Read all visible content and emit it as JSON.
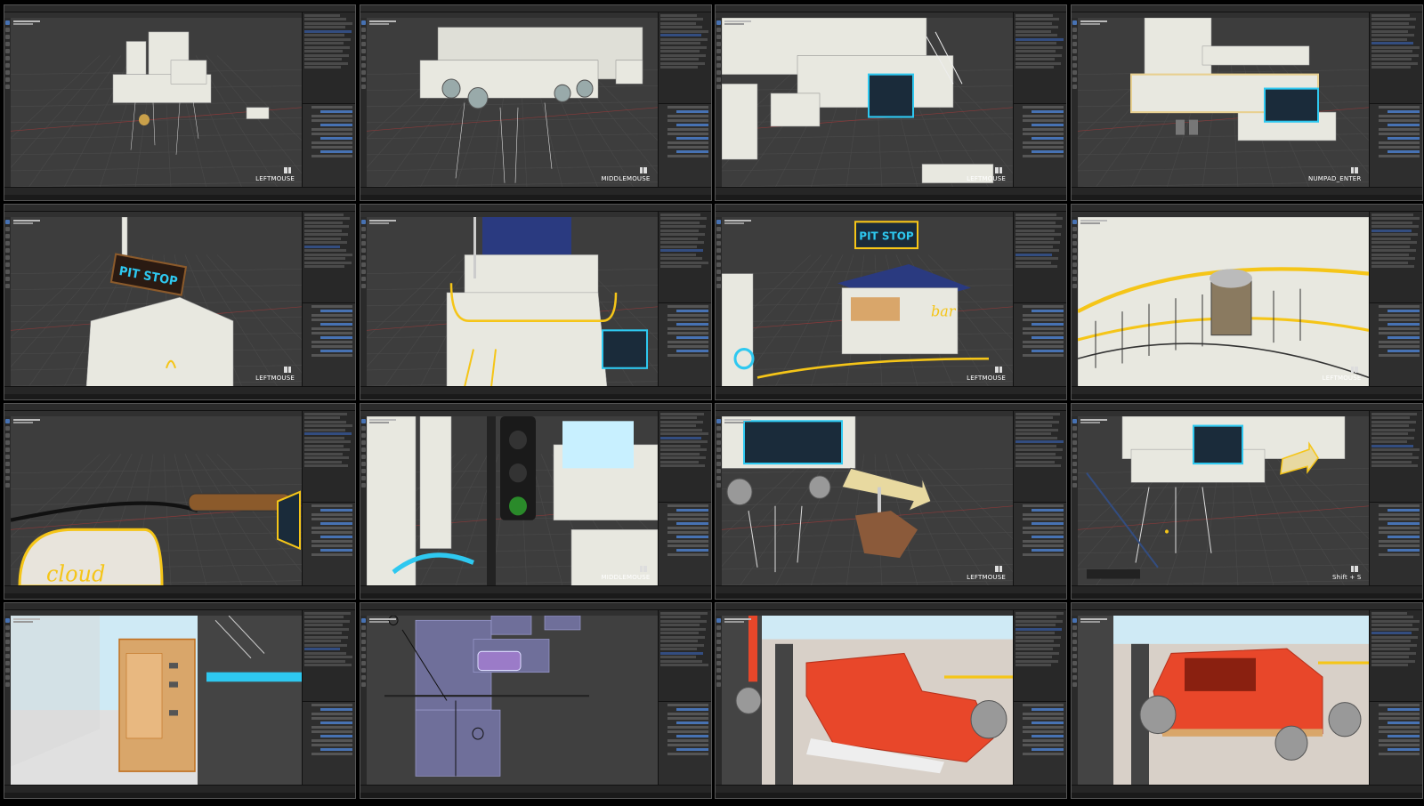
{
  "frames": [
    {
      "keycast": "LEFTMOUSE"
    },
    {
      "keycast": "MIDDLEMOUSE"
    },
    {
      "keycast": "LEFTMOUSE"
    },
    {
      "keycast": "NUMPAD_ENTER"
    },
    {
      "keycast": "LEFTMOUSE"
    },
    {
      "keycast": ""
    },
    {
      "keycast": "LEFTMOUSE"
    },
    {
      "keycast": "LEFTMOUSE"
    },
    {
      "keycast": ""
    },
    {
      "keycast": "MIDDLEMOUSE"
    },
    {
      "keycast": "LEFTMOUSE"
    },
    {
      "keycast": "Shift + S"
    },
    {
      "keycast": ""
    },
    {
      "keycast": ""
    },
    {
      "keycast": ""
    },
    {
      "keycast": ""
    }
  ],
  "scene_text": {
    "pitstop_sign": "PIT STOP",
    "cloud_sign": "cloud",
    "bar_sign": "bar",
    "bar_sign_2": "bar"
  },
  "colors": {
    "viewport_bg": "#3d3d3d",
    "model_white": "#e8e8e0",
    "neon_cyan": "#2ec8f0",
    "accent_yellow": "#f5c518",
    "car_red": "#e8472a",
    "selection_blue": "#4772b3"
  }
}
